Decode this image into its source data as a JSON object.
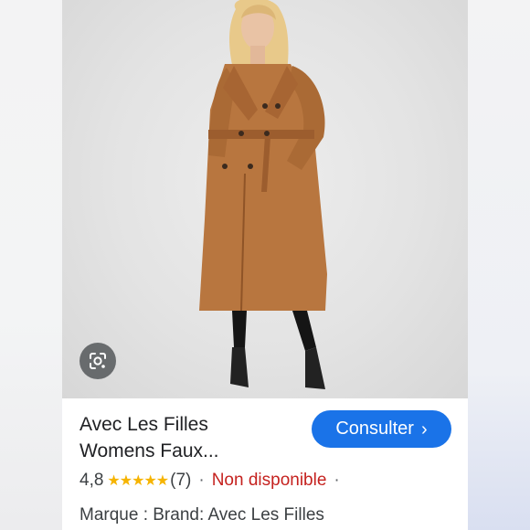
{
  "product": {
    "title_line1": "Avec Les Filles",
    "title_line2": "Womens Faux...",
    "image_alt": "Woman wearing a long camel faux leather trench coat"
  },
  "actions": {
    "consult_label": "Consulter",
    "consult_chevron": "›",
    "lens_icon": "google-lens-icon"
  },
  "rating": {
    "value": "4,8",
    "stars": "★★★★★",
    "count": "(7)",
    "separator": "·",
    "availability": "Non disponible",
    "trailing_separator": "·"
  },
  "brand": {
    "text": "Marque : Brand: Avec Les Filles"
  },
  "colors": {
    "accent": "#1a73e8",
    "unavailable": "#c5221f",
    "star": "#f6b400",
    "coat": "#b8763f"
  }
}
